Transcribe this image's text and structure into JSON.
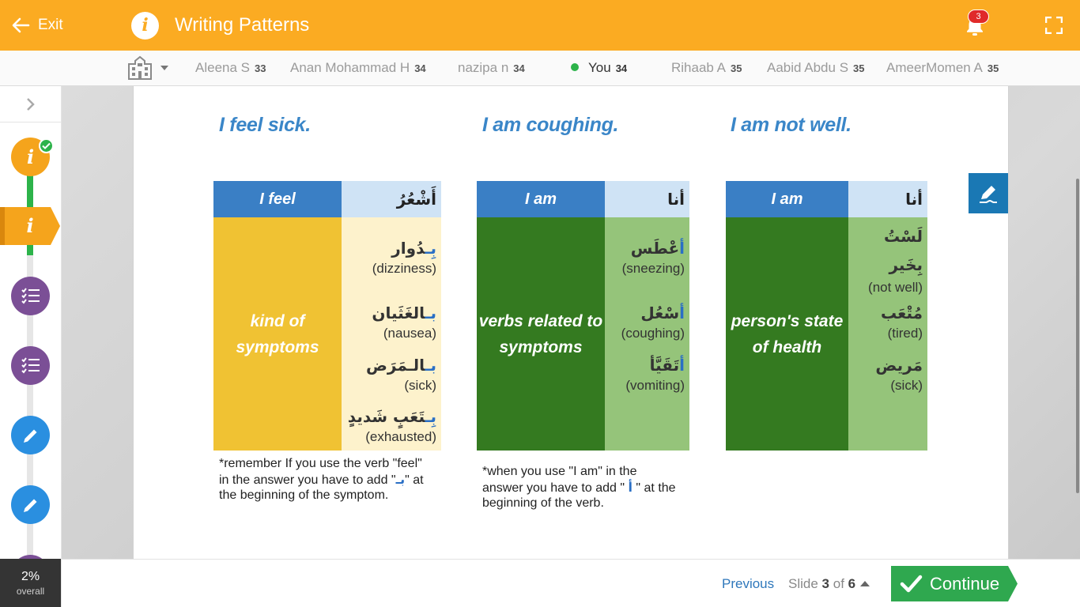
{
  "header": {
    "exit_label": "Exit",
    "title": "Writing Patterns",
    "notification_count": "3",
    "colors": {
      "bar": "#fbab22"
    }
  },
  "leaderboard": {
    "school_icon": "school-icon",
    "entries": [
      {
        "name": "Aleena S",
        "score": "33"
      },
      {
        "name": "Anan Mohammad H",
        "score": "34"
      },
      {
        "name": "nazipa n",
        "score": "34"
      },
      {
        "name": "You",
        "score": "34"
      },
      {
        "name": "Rihaab A",
        "score": "35"
      },
      {
        "name": "Aabid Abdu S",
        "score": "35"
      },
      {
        "name": "AmeerMomen A",
        "score": "35"
      }
    ]
  },
  "rail": {
    "progress_value": "2%",
    "progress_label": "overall",
    "steps": [
      {
        "type": "info",
        "glyph": "i",
        "status": "completed"
      },
      {
        "type": "info",
        "glyph": "i",
        "status": "active"
      },
      {
        "type": "checklist"
      },
      {
        "type": "checklist"
      },
      {
        "type": "writing"
      },
      {
        "type": "writing"
      }
    ]
  },
  "slide": {
    "columns": [
      {
        "heading": "I feel sick.",
        "header_en": "I feel",
        "header_ar": "أَشْعُرُ",
        "category": "kind of symptoms",
        "category_color": "#f0c233",
        "right_color": "#fdf2cc",
        "entries": [
          {
            "ar_prefix": "بِـ",
            "ar_rest": "دُوار",
            "en": "(dizziness)"
          },
          {
            "ar_prefix": "بـ",
            "ar_rest": "الغَثَيان",
            "en": "(nausea)"
          },
          {
            "ar_prefix": "بـ",
            "ar_rest": "الـمَرَض",
            "en": "(sick)"
          },
          {
            "ar_prefix": "بِـ",
            "ar_rest": "تَعَبٍ شَديدٍ",
            "en": "(exhausted)"
          }
        ],
        "note_before": "*remember If you use the verb \"feel\" in the answer you have to add \"",
        "note_ar": "بـ",
        "note_after": "\" at the beginning of the symptom."
      },
      {
        "heading": "I am coughing.",
        "header_en": "I am",
        "header_ar": "أنا",
        "category": "verbs related to symptoms",
        "category_color": "#347a20",
        "right_color": "#95c47a",
        "entries": [
          {
            "ar_prefix": "أ",
            "ar_rest": "عْطَس",
            "en": "(sneezing)"
          },
          {
            "ar_prefix": "أ",
            "ar_rest": "سْعُل",
            "en": "(coughing)"
          },
          {
            "ar_prefix": "أ",
            "ar_rest": "تَقَيَّأ",
            "en": "(vomiting)"
          }
        ],
        "note_before": "*when you use \"I am\" in the answer you have to add \" ",
        "note_ar": "أ",
        "note_after": " \" at the beginning of the verb."
      },
      {
        "heading": "I am not well.",
        "header_en": "I am",
        "header_ar": "أنا",
        "category": "person's state of health",
        "category_color": "#347a20",
        "right_color": "#95c47a",
        "entries": [
          {
            "ar_prefix": "",
            "ar_rest": "لَسْتُ بِخَير",
            "en": "(not well)"
          },
          {
            "ar_prefix": "",
            "ar_rest": "مُتْعَب",
            "en": "(tired)"
          },
          {
            "ar_prefix": "",
            "ar_rest": "مَريض",
            "en": "(sick)"
          }
        ]
      }
    ]
  },
  "footer": {
    "previous_label": "Previous",
    "slide_word": "Slide",
    "slide_current": "3",
    "slide_of": "of",
    "slide_total": "6",
    "continue_label": "Continue",
    "continue_color": "#2fa84f"
  }
}
